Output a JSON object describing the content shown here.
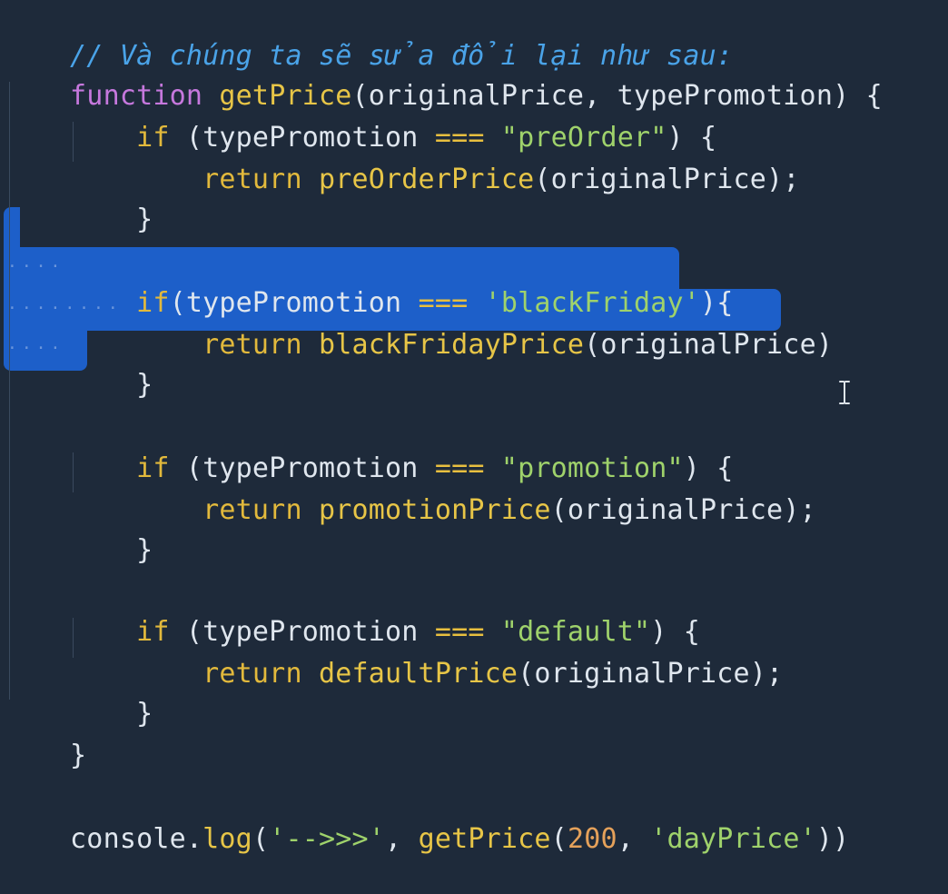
{
  "code": {
    "comment": "// Và chúng ta sẽ sửa đổi lại như sau:",
    "func_kw": "function",
    "func_name": "getPrice",
    "func_params": "(originalPrice, typePromotion)",
    "open_brace": " {",
    "if_kw": "if",
    "return_kw": "return",
    "block1_cond_pre": " (typePromotion ",
    "block1_op": "===",
    "block1_str": "\"preOrder\"",
    "block1_cond_post": ") {",
    "block1_fn": "preOrderPrice",
    "block1_args": "(originalPrice);",
    "close_brace": "}",
    "block2_cond_pre": "(typePromotion ",
    "block2_op": "===",
    "block2_str": "'blackFriday'",
    "block2_cond_post": "){",
    "block2_fn": "blackFridayPrice",
    "block2_args": "(originalPrice)",
    "block3_cond_pre": " (typePromotion ",
    "block3_op": "===",
    "block3_str": "\"promotion\"",
    "block3_cond_post": ") {",
    "block3_fn": "promotionPrice",
    "block3_args": "(originalPrice);",
    "block4_cond_pre": " (typePromotion ",
    "block4_op": "===",
    "block4_str": "\"default\"",
    "block4_cond_post": ") {",
    "block4_fn": "defaultPrice",
    "block4_args": "(originalPrice);",
    "console_obj": "console.",
    "console_fn": "log",
    "console_open": "(",
    "console_str1": "'-->>>'",
    "console_sep": ", ",
    "console_call": "getPrice",
    "console_paren": "(",
    "console_num": "200",
    "console_str2": "'dayPrice'",
    "console_close": "))"
  },
  "colors": {
    "background": "#1e2a3a",
    "selection": "#1d5fc9",
    "comment": "#4aa3e8",
    "keyword": "#c678dd",
    "function": "#e7c547",
    "string": "#9fd26b",
    "number": "#e5a15a"
  },
  "icons": {
    "cursor": "text-cursor-icon"
  }
}
